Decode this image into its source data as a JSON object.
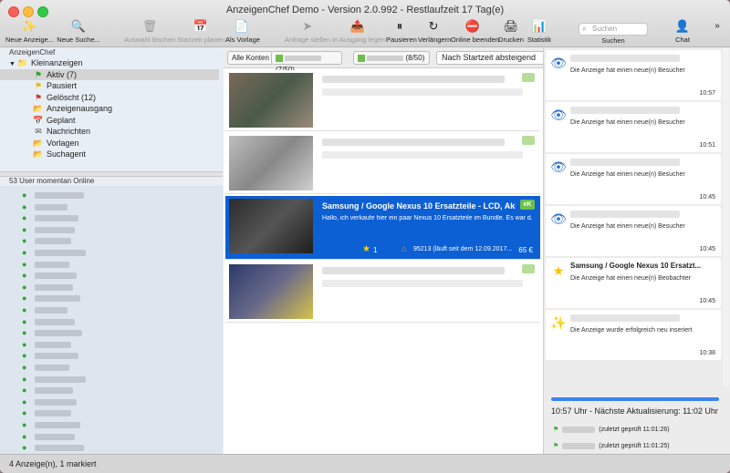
{
  "window": {
    "title": "AnzeigenChef Demo - Version 2.0.992 - Restlaufzeit 17 Tag(e)"
  },
  "toolbar": [
    {
      "label": "Neue Anzeige...",
      "icon": "wand-icon",
      "glyph": "✨",
      "enabled": true
    },
    {
      "label": "Neue Suche...",
      "icon": "search-doc-icon",
      "glyph": "🔍",
      "enabled": true
    },
    {
      "label": "Auswahl löschen",
      "icon": "trash-icon",
      "glyph": "🗑",
      "enabled": false
    },
    {
      "label": "Startzeit planen",
      "icon": "calendar-icon",
      "glyph": "📅",
      "enabled": false
    },
    {
      "label": "Als Vorlage",
      "icon": "template-icon",
      "glyph": "📄",
      "enabled": true
    },
    {
      "label": "Anfrage stellen",
      "icon": "send-icon",
      "glyph": "➤",
      "enabled": false
    },
    {
      "label": "In Ausgang legen",
      "icon": "outbox-icon",
      "glyph": "📤",
      "enabled": false
    },
    {
      "label": "Pausieren",
      "icon": "pause-icon",
      "glyph": "⏸",
      "enabled": true
    },
    {
      "label": "Verlängern",
      "icon": "extend-icon",
      "glyph": "↻",
      "enabled": true
    },
    {
      "label": "Online beenden",
      "icon": "stop-online-icon",
      "glyph": "⛔",
      "enabled": true
    },
    {
      "label": "Drucken",
      "icon": "printer-icon",
      "glyph": "🖨",
      "enabled": true
    },
    {
      "label": "Statistik",
      "icon": "chart-icon",
      "glyph": "📊",
      "enabled": true
    }
  ],
  "search": {
    "placeholder": "Suchen",
    "label": "Suchen"
  },
  "chat": {
    "label": "Chat"
  },
  "tree": {
    "header": "AnzeigenChef",
    "items": [
      {
        "label": "Kleinanzeigen",
        "icon": "folder-icon",
        "glyph": "📁",
        "indent": 0,
        "selected": false
      },
      {
        "label": "Aktiv (7)",
        "icon": "flag-green-icon",
        "glyph": "⚑",
        "indent": 1,
        "selected": true
      },
      {
        "label": "Pausiert",
        "icon": "flag-yellow-icon",
        "glyph": "⚑",
        "indent": 1,
        "selected": false
      },
      {
        "label": "Gelöscht (12)",
        "icon": "flag-red-icon",
        "glyph": "⚑",
        "indent": 1,
        "selected": false
      },
      {
        "label": "Anzeigenausgang",
        "icon": "outbox-folder-icon",
        "glyph": "📂",
        "indent": 1,
        "selected": false
      },
      {
        "label": "Geplant",
        "icon": "calendar-icon",
        "glyph": "📅",
        "indent": 1,
        "selected": false
      },
      {
        "label": "Nachrichten",
        "icon": "messages-icon",
        "glyph": "✉",
        "indent": 1,
        "selected": false
      },
      {
        "label": "Vorlagen",
        "icon": "templates-folder-icon",
        "glyph": "📂",
        "indent": 1,
        "selected": false
      },
      {
        "label": "Suchagent",
        "icon": "searchagent-folder-icon",
        "glyph": "📂",
        "indent": 1,
        "selected": false
      }
    ]
  },
  "users": {
    "header": "53 User momentan Online",
    "rows": 23
  },
  "filter": {
    "all_accounts": "Alle Konten",
    "account1_count": "(7/50)",
    "account2_count": "(8/50)",
    "sort": "Nach Startzeit absteigend"
  },
  "selected_ad": {
    "title": "Samsung / Google Nexus 10 Ersatzteile - LCD, Akk...",
    "description": "Hallo, ich verkaufe hier ein paar Nexus 10 Ersatzteile im Bundle. Es war d...",
    "badge": "eK",
    "watchers": "1",
    "location": "95213 (läuft seit dem 12.09.2017...",
    "price": "65 €"
  },
  "notifications": [
    {
      "icon": "eye-icon",
      "glyph": "👁",
      "title": "",
      "text": "Die Anzeige hat einen neue(n) Besucher",
      "time": "10:57"
    },
    {
      "icon": "eye-icon",
      "glyph": "👁",
      "title": "",
      "text": "Die Anzeige hat einen neue(n) Besucher",
      "time": "10:51"
    },
    {
      "icon": "eye-icon",
      "glyph": "👁",
      "title": "",
      "text": "Die Anzeige hat einen neue(n) Besucher",
      "time": "10:45"
    },
    {
      "icon": "eye-icon",
      "glyph": "👁",
      "title": "",
      "text": "Die Anzeige hat einen neue(n) Besucher",
      "time": "10:45"
    },
    {
      "icon": "star-icon",
      "glyph": "★",
      "title": "Samsung / Google Nexus 10 Ersatzt...",
      "text": "Die Anzeige hat einen neue(n) Beobachter",
      "time": "10:45"
    },
    {
      "icon": "wand-icon",
      "glyph": "✨",
      "title": "",
      "text": "Die Anzeige wurde erfolgreich neu inseriert",
      "time": "10:38"
    }
  ],
  "update": {
    "progress": 1.0,
    "text": "10:57 Uhr - Nächste Aktualisierung: 11:02 Uhr",
    "checks": [
      "(zuletzt geprüft 11:01:26)",
      "(zuletzt geprüft 11:01:25)"
    ]
  },
  "statusbar": "4 Anzeige(n), 1 markiert",
  "colors": {
    "selection": "#0d5fd4",
    "accent": "#3a84f0",
    "online_green": "#2da52d",
    "badge_green": "#6cc04a"
  }
}
